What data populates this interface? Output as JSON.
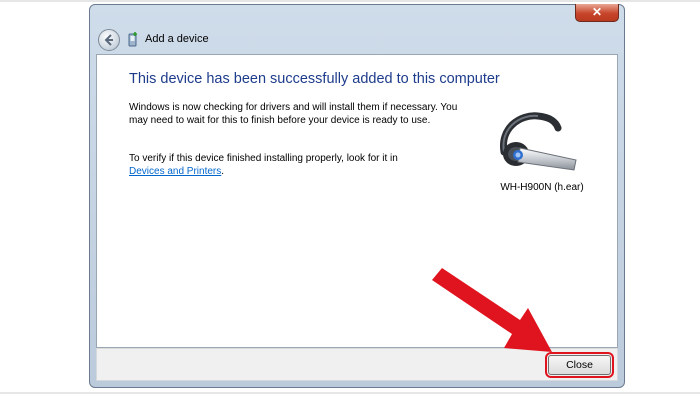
{
  "window": {
    "title": "Add a device",
    "close_glyph": "✕"
  },
  "main": {
    "heading": "This device has been successfully added to this computer",
    "paragraph1": "Windows is now checking for drivers and will install them if necessary. You may need to wait for this to finish before your device is ready to use.",
    "paragraph2_prefix": "To verify if this device finished installing properly, look for it in",
    "paragraph2_link": "Devices and Printers",
    "paragraph2_suffix": "."
  },
  "device": {
    "name": "WH-H900N (h.ear)",
    "icon": "headset-icon"
  },
  "footer": {
    "close_label": "Close"
  },
  "annotation": {
    "arrow_color": "#e0141e",
    "highlight_color": "#e0141e"
  }
}
